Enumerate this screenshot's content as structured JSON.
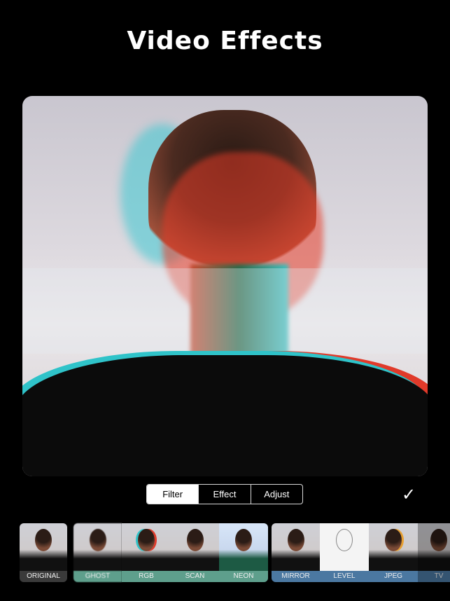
{
  "header": {
    "title": "Video Effects"
  },
  "tabs": [
    {
      "label": "Filter",
      "selected": true
    },
    {
      "label": "Effect",
      "selected": false
    },
    {
      "label": "Adjust",
      "selected": false
    }
  ],
  "confirm_icon": "checkmark-icon",
  "filters": [
    {
      "label": "ORIGINAL",
      "group": "none",
      "selected": true
    },
    {
      "label": "GHOST",
      "group": "green"
    },
    {
      "label": "RGB",
      "group": "green"
    },
    {
      "label": "SCAN",
      "group": "green"
    },
    {
      "label": "NEON",
      "group": "green"
    },
    {
      "label": "MIRROR",
      "group": "blue"
    },
    {
      "label": "LEVEL",
      "group": "blue"
    },
    {
      "label": "JPEG",
      "group": "blue"
    },
    {
      "label": "TV",
      "group": "blue"
    }
  ],
  "colors": {
    "green_group": "#5e9f8c",
    "blue_group": "#4b78a1",
    "background": "#000000"
  }
}
